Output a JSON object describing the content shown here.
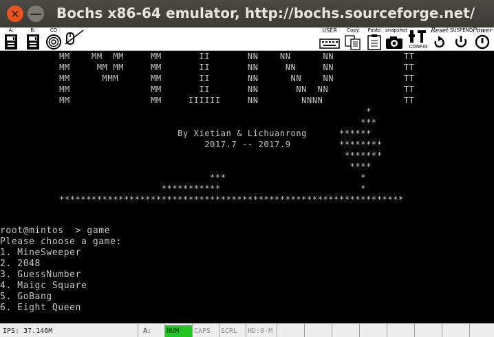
{
  "window": {
    "title": "Bochs x86-64 emulator, http://bochs.sourceforge.net/",
    "close_glyph": "✕",
    "minimize_glyph": "—"
  },
  "toolbar": {
    "floppy_a": "A:",
    "floppy_b": "B:",
    "cdrom": "CD",
    "user": "USER",
    "copy": "Copy",
    "paste": "Paste",
    "snapshot": "snapshot",
    "config": "CONFIG",
    "reset": "Reset",
    "suspend": "SUSPEND",
    "power": "Power"
  },
  "console": {
    "lines": [
      "           MM    MM  MM     MM       II       NN    NN      NN             TT",
      "           MM     MM MM     MM       II       NN     NN     NN             TT",
      "           MM      MMM      MM       II       NN      NN    NN             TT",
      "           MM               MM       II       NN       NN  NN              TT",
      "           MM               MM     IIIIII     NN        NNNN               TT",
      "                                                                    *",
      "                                                                   ***",
      "                                 By Xietian & Lichuanrong      ******",
      "                                      2017.7 -- 2017.9         ********",
      "                                                                *******",
      "                                                                 ****",
      "                                       ***                         *",
      "                              ***********                          *",
      "           ****************************************************************",
      "",
      "",
      "root@mintos  > game",
      "Please choose a game:",
      "1. MineSweeper",
      "2. 2048",
      "3. GuessNumber",
      "4. Maigc Square",
      "5. GoBang",
      "6. Eight Queen"
    ]
  },
  "status": {
    "ips": "IPS: 37.146M",
    "drive": "A:",
    "num": "NUM",
    "caps": "CAPS",
    "scrl": "SCRL",
    "hd": "HD:0-M"
  },
  "colors": {
    "titlebar": "#3c3b37",
    "close": "#e9541f",
    "console_text": "#c8c8c8",
    "num_on": "#22c322"
  }
}
